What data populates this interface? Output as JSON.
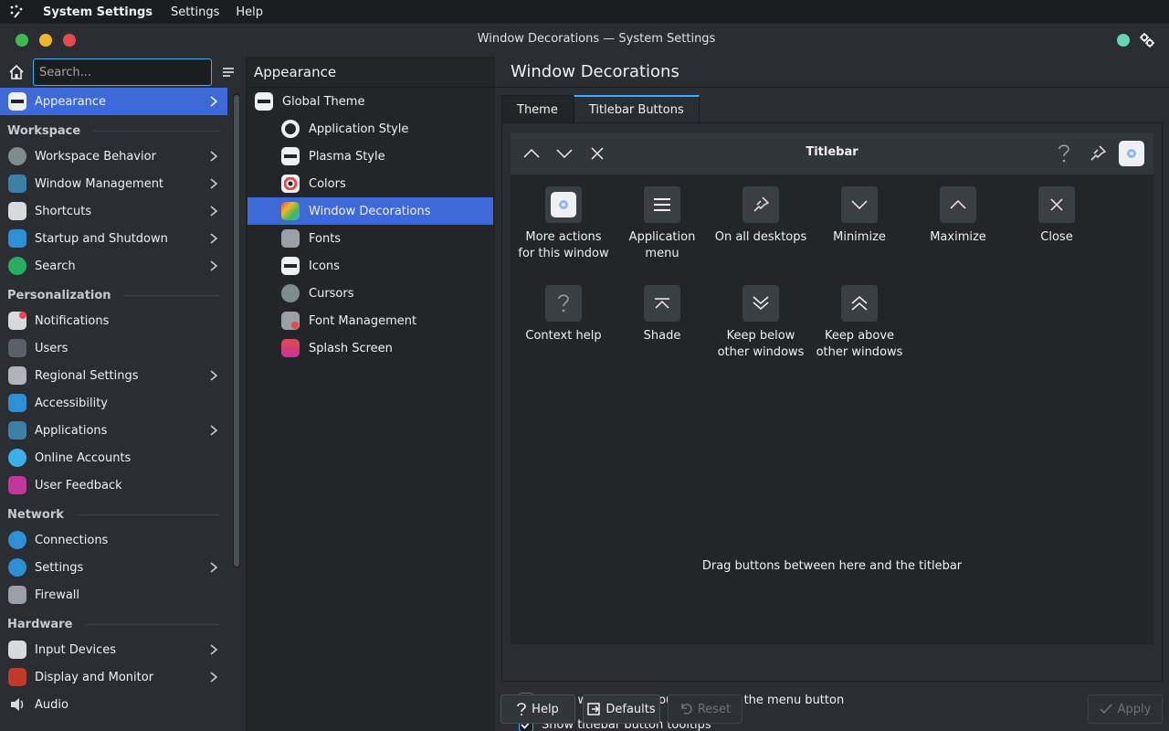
{
  "menubar": {
    "app_title": "System Settings",
    "menus": [
      "Settings",
      "Help"
    ]
  },
  "window": {
    "title": "Window Decorations — System Settings"
  },
  "sidebar": {
    "search_placeholder": "Search...",
    "appearance": "Appearance",
    "workspace_title": "Workspace",
    "workspace": [
      "Workspace Behavior",
      "Window Management",
      "Shortcuts",
      "Startup and Shutdown",
      "Search"
    ],
    "personalization_title": "Personalization",
    "personalization": [
      "Notifications",
      "Users",
      "Regional Settings",
      "Accessibility",
      "Applications",
      "Online Accounts",
      "User Feedback"
    ],
    "network_title": "Network",
    "network": [
      "Connections",
      "Settings",
      "Firewall"
    ],
    "hardware_title": "Hardware",
    "hardware": [
      "Input Devices",
      "Display and Monitor",
      "Audio"
    ]
  },
  "middle": {
    "header": "Appearance",
    "items": [
      "Global Theme",
      "Application Style",
      "Plasma Style",
      "Colors",
      "Window Decorations",
      "Fonts",
      "Icons",
      "Cursors",
      "Font Management",
      "Splash Screen"
    ]
  },
  "right": {
    "header": "Window Decorations",
    "tabs": [
      "Theme",
      "Titlebar Buttons"
    ],
    "preview_title": "Titlebar",
    "buttons": [
      {
        "label1": "More actions",
        "label2": "for this window"
      },
      {
        "label1": "Application",
        "label2": "menu"
      },
      {
        "label1": "On all desktops",
        "label2": ""
      },
      {
        "label1": "Minimize",
        "label2": ""
      },
      {
        "label1": "Maximize",
        "label2": ""
      },
      {
        "label1": "Close",
        "label2": ""
      },
      {
        "label1": "Context help",
        "label2": ""
      },
      {
        "label1": "Shade",
        "label2": ""
      },
      {
        "label1": "Keep below",
        "label2": "other windows"
      },
      {
        "label1": "Keep above",
        "label2": "other windows"
      }
    ],
    "drag_hint": "Drag buttons between here and the titlebar",
    "check_close_dblclick": "Close windows by double clicking the menu button",
    "check_close_dblclick_checked": false,
    "check_tooltips": "Show titlebar button tooltips",
    "check_tooltips_checked": true
  },
  "footer": {
    "help": "Help",
    "defaults": "Defaults",
    "reset": "Reset",
    "apply": "Apply"
  },
  "colors": {
    "accent": "#3d6ad6",
    "focus": "#3daee9"
  }
}
